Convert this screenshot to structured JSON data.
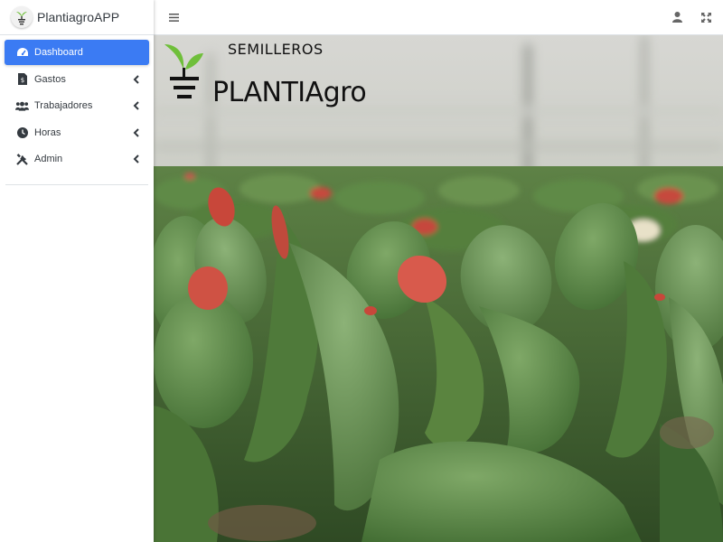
{
  "app": {
    "name": "PlantiagroAPP"
  },
  "sidebar": {
    "items": [
      {
        "label": "Dashboard",
        "icon": "dashboard-gauge-icon",
        "active": true,
        "has_submenu": false
      },
      {
        "label": "Gastos",
        "icon": "invoice-icon",
        "active": false,
        "has_submenu": true
      },
      {
        "label": "Trabajadores",
        "icon": "users-icon",
        "active": false,
        "has_submenu": true
      },
      {
        "label": "Horas",
        "icon": "clock-icon",
        "active": false,
        "has_submenu": true
      },
      {
        "label": "Admin",
        "icon": "tools-icon",
        "active": false,
        "has_submenu": true
      }
    ]
  },
  "topbar": {
    "menu_icon": "hamburger-icon",
    "user_icon": "user-icon",
    "fullscreen_icon": "expand-icon"
  },
  "hero": {
    "logo_top_text": "SEMILLEROS",
    "logo_main_text": "PLANTIAgro",
    "description_icon": "seedling-logo"
  },
  "colors": {
    "active_item": "#3b7bf3",
    "leaf_green": "#4f7f3c",
    "seed_red": "#d9534f",
    "logo_green": "#6fbf3a"
  }
}
